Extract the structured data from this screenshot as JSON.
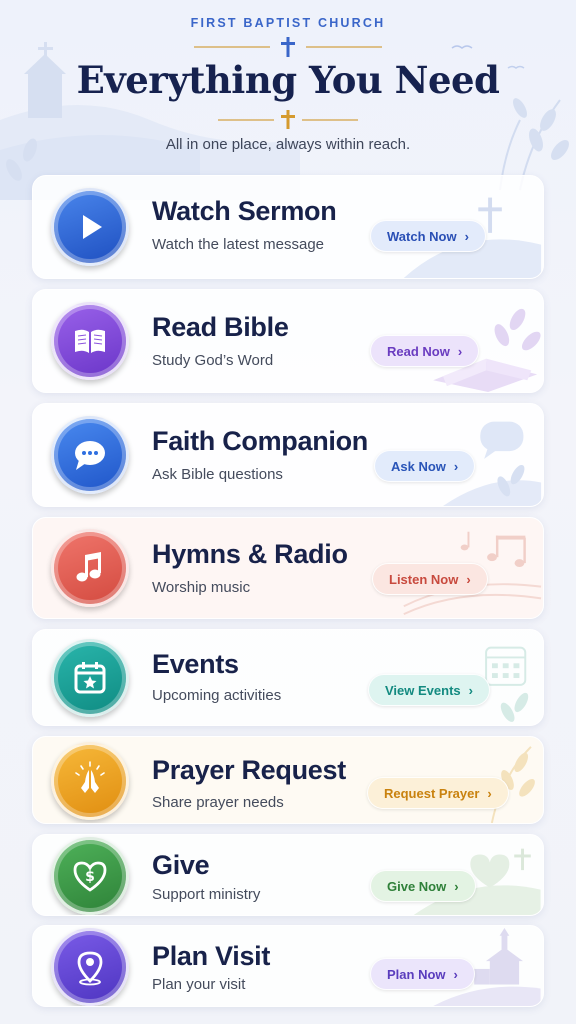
{
  "header": {
    "church_name": "FIRST BAPTIST CHURCH",
    "title": "Everything You Need",
    "subtitle": "All in one place, always within reach."
  },
  "cards": [
    {
      "title": "Watch Sermon",
      "subtitle": "Watch the latest message",
      "button": "Watch Now",
      "icon": "play-icon",
      "color": "#2f64d6",
      "btn_color": "#2a4fb5",
      "btn_bg": "#e3ebfb"
    },
    {
      "title": "Read Bible",
      "subtitle": "Study God’s Word",
      "button": "Read Now",
      "icon": "book-icon",
      "color": "#7d45d8",
      "btn_color": "#6a3cc0",
      "btn_bg": "#ece3fb"
    },
    {
      "title": "Faith Companion",
      "subtitle": "Ask Bible questions",
      "button": "Ask Now",
      "icon": "chat-bubble-icon",
      "color": "#2f6fe0",
      "btn_color": "#2a55b8",
      "btn_bg": "#e2ebfb"
    },
    {
      "title": "Hymns & Radio",
      "subtitle": "Worship music",
      "button": "Listen Now",
      "icon": "music-note-icon",
      "color": "#e0564d",
      "btn_color": "#c84a3e",
      "btn_bg": "#fbe6e1"
    },
    {
      "title": "Events",
      "subtitle": "Upcoming activities",
      "button": "View Events",
      "icon": "calendar-icon",
      "color": "#1aa39b",
      "btn_color": "#138a80",
      "btn_bg": "#def4f0"
    },
    {
      "title": "Prayer Request",
      "subtitle": "Share prayer needs",
      "button": "Request Prayer",
      "icon": "praying-hands-icon",
      "color": "#eea21f",
      "btn_color": "#c9820f",
      "btn_bg": "#fcf0d8"
    },
    {
      "title": "Give",
      "subtitle": "Support ministry",
      "button": "Give Now",
      "icon": "heart-dollar-icon",
      "color": "#3d9a48",
      "btn_color": "#2f8039",
      "btn_bg": "#e3f3e3"
    },
    {
      "title": "Plan Visit",
      "subtitle": "Plan your visit",
      "button": "Plan Now",
      "icon": "location-pin-icon",
      "color": "#6a4ad8",
      "btn_color": "#5a3dbd",
      "btn_bg": "#ebe5fb"
    }
  ]
}
